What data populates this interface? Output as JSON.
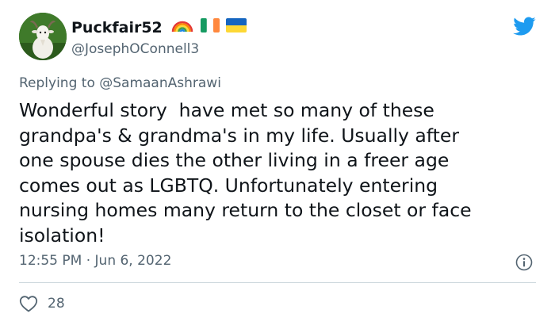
{
  "user": {
    "display_name": "Puckfair52",
    "handle": "@JosephOConnell3",
    "flags": [
      "rainbow-emoji",
      "ireland-flag-emoji",
      "ukraine-flag-emoji"
    ]
  },
  "reply": {
    "prefix": "Replying to",
    "mention": "@SamaanAshrawi"
  },
  "tweet": {
    "text": "Wonderful story  have met so many of these\ngrandpa's & grandma's in my life. Usually after\none spouse dies the other living in a freer age\ncomes out as LGBTQ. Unfortunately entering\nnursing homes many return to the closet or face\nisolation!",
    "timestamp": "12:55 PM · Jun 6, 2022"
  },
  "stats": {
    "likes": "28"
  },
  "icons": {
    "brand": "twitter-bird-icon",
    "info": "info-icon",
    "like": "heart-icon"
  },
  "colors": {
    "brand_blue": "#1d9bf0",
    "text_primary": "#0f1419",
    "text_secondary": "#536471",
    "divider": "#cfd9de"
  }
}
